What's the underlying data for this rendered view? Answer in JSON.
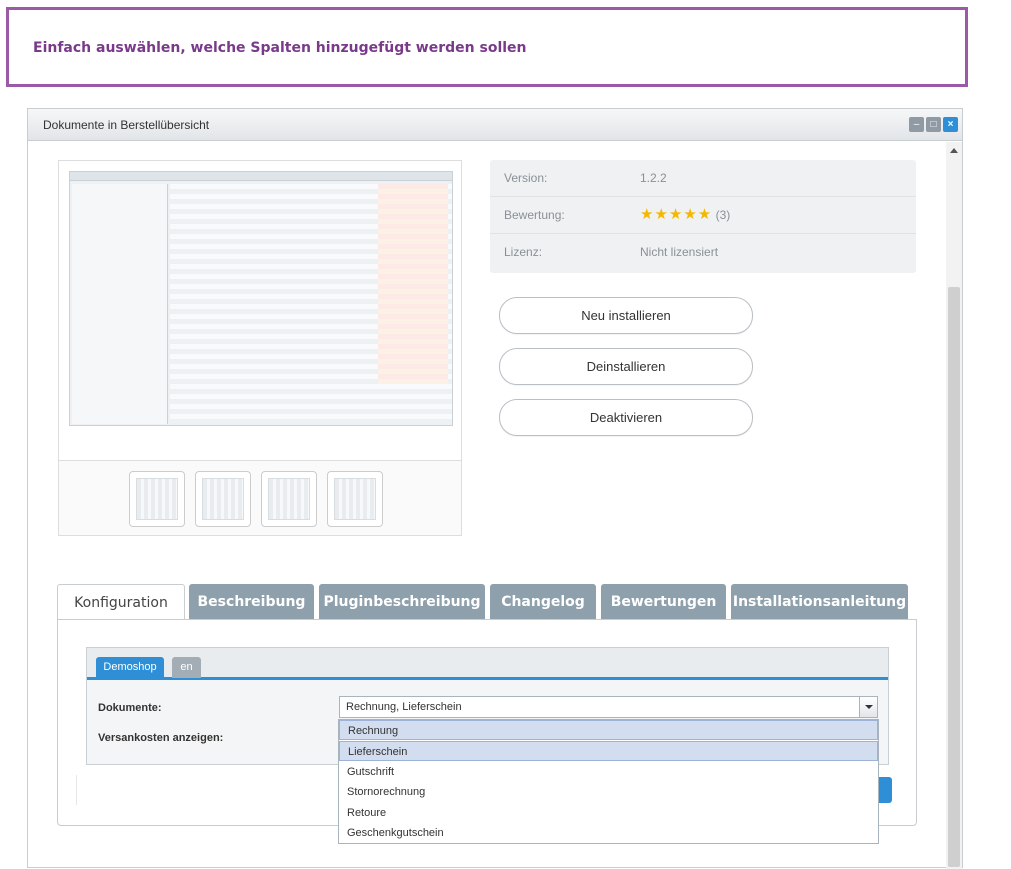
{
  "banner": {
    "text": "Einfach auswählen, welche Spalten hinzugefügt werden sollen"
  },
  "window": {
    "title": "Dokumente in Berstellübersicht",
    "buttons": [
      "minimize",
      "maximize",
      "close"
    ]
  },
  "info": {
    "version_label": "Version:",
    "version_value": "1.2.2",
    "rating_label": "Bewertung:",
    "rating_stars": "★★★★★",
    "rating_count": "(3)",
    "license_label": "Lizenz:",
    "license_value": "Nicht lizensiert"
  },
  "actions": {
    "install": "Neu installieren",
    "uninstall": "Deinstallieren",
    "deactivate": "Deaktivieren"
  },
  "tabs": [
    {
      "label": "Konfiguration",
      "active": true
    },
    {
      "label": "Beschreibung"
    },
    {
      "label": "Pluginbeschreibung"
    },
    {
      "label": "Changelog"
    },
    {
      "label": "Bewertungen"
    },
    {
      "label": "Installationsanleitung"
    }
  ],
  "subtabs": [
    {
      "label": "Demoshop",
      "active": true
    },
    {
      "label": "en"
    }
  ],
  "form": {
    "documents_label": "Dokumente:",
    "documents_value": "Rechnung, Lieferschein",
    "shipping_label": "Versankosten anzeigen:"
  },
  "dropdown": {
    "options": [
      "Rechnung",
      "Lieferschein",
      "Gutschrift",
      "Stornorechnung",
      "Retoure",
      "Geschenkgutschein"
    ],
    "selected": [
      "Rechnung",
      "Lieferschein"
    ]
  },
  "colors": {
    "accent": "#2e8fd6",
    "banner_border": "#9b5aa6",
    "banner_text": "#7a3a8a",
    "tab_inactive": "#8fa0ad",
    "stars": "#f5b800"
  }
}
